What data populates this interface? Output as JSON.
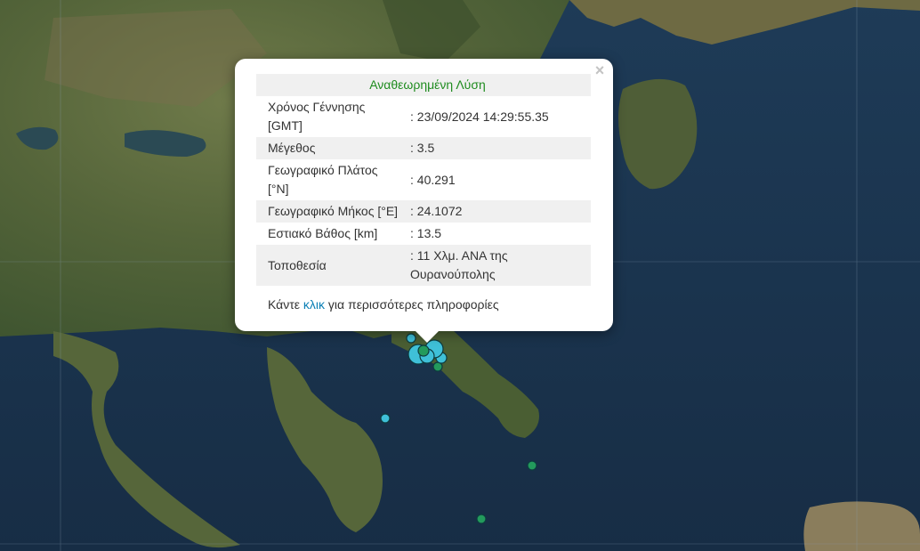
{
  "map": {
    "quake_colors": {
      "recent": "#3fc0d8",
      "older": "#239a5c",
      "outline": "#0d3b3f"
    }
  },
  "popup": {
    "header": "Αναθεωρημένη Λύση",
    "rows": [
      {
        "label": "Χρόνος Γέννησης [GMT]",
        "value": ": 23/09/2024 14:29:55.35"
      },
      {
        "label": "Μέγεθος",
        "value": ": 3.5"
      },
      {
        "label": "Γεωγραφικό Πλάτος [°N]",
        "value": ": 40.291"
      },
      {
        "label": "Γεωγραφικό Μήκος [°E]",
        "value": ": 24.1072"
      },
      {
        "label": "Εστιακό Βάθος [km]",
        "value": ": 13.5"
      },
      {
        "label": "Τοποθεσία",
        "value": ": 11 Χλμ. ΑΝΑ της Ουρανούπολης"
      }
    ],
    "more_prefix": "Κάντε ",
    "more_link": "κλικ",
    "more_suffix": " για περισσότερες πληροφορίες",
    "close_symbol": "×"
  }
}
